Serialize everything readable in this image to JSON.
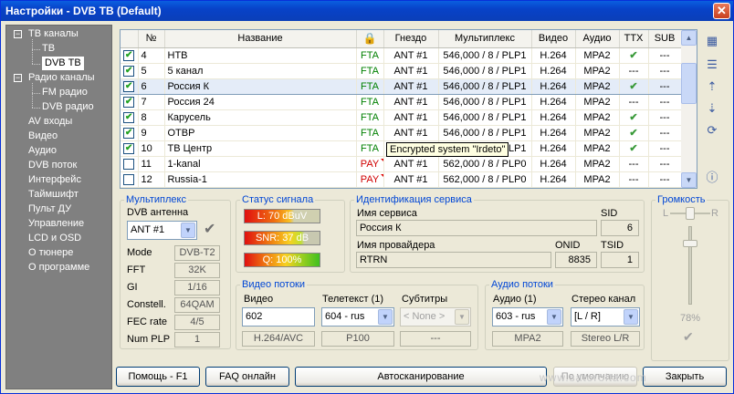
{
  "window": {
    "title": "Настройки - DVB TB (Default)",
    "close_label": "✕"
  },
  "tree": [
    {
      "label": "ТВ каналы",
      "level": 0,
      "toggle": "−"
    },
    {
      "label": "ТВ",
      "level": 1
    },
    {
      "label": "DVB ТВ",
      "level": 1,
      "selected": true
    },
    {
      "label": "Радио каналы",
      "level": 0,
      "toggle": "−"
    },
    {
      "label": "FM радио",
      "level": 1
    },
    {
      "label": "DVB радио",
      "level": 1
    },
    {
      "label": "AV входы",
      "level": 0
    },
    {
      "label": "Видео",
      "level": 0
    },
    {
      "label": "Аудио",
      "level": 0
    },
    {
      "label": "DVB поток",
      "level": 0
    },
    {
      "label": "Интерфейс",
      "level": 0
    },
    {
      "label": "Таймшифт",
      "level": 0
    },
    {
      "label": "Пульт ДУ",
      "level": 0
    },
    {
      "label": "Управление",
      "level": 0
    },
    {
      "label": "LCD и OSD",
      "level": 0
    },
    {
      "label": "О тюнере",
      "level": 0
    },
    {
      "label": "О программе",
      "level": 0
    }
  ],
  "table": {
    "columns": [
      "№",
      "Название",
      "",
      "Гнездо",
      "Мультиплекс",
      "Видео",
      "Аудио",
      "TTX",
      "SUB"
    ],
    "rows": [
      {
        "checked": true,
        "num": "4",
        "name": "НТВ",
        "enc": "FTA",
        "socket": "ANT #1",
        "mux": "546,000 / 8 / PLP1",
        "video": "H.264",
        "audio": "MPA2",
        "ttx": "✔",
        "sub": "---"
      },
      {
        "checked": true,
        "num": "5",
        "name": "5 канал",
        "enc": "FTA",
        "socket": "ANT #1",
        "mux": "546,000 / 8 / PLP1",
        "video": "H.264",
        "audio": "MPA2",
        "ttx": "---",
        "sub": "---"
      },
      {
        "checked": true,
        "num": "6",
        "name": "Россия К",
        "enc": "FTA",
        "socket": "ANT #1",
        "mux": "546,000 / 8 / PLP1",
        "video": "H.264",
        "audio": "MPA2",
        "ttx": "✔",
        "sub": "---",
        "selected": true
      },
      {
        "checked": true,
        "num": "7",
        "name": "Россия 24",
        "enc": "FTA",
        "socket": "ANT #1",
        "mux": "546,000 / 8 / PLP1",
        "video": "H.264",
        "audio": "MPA2",
        "ttx": "---",
        "sub": "---"
      },
      {
        "checked": true,
        "num": "8",
        "name": "Карусель",
        "enc": "FTA",
        "socket": "ANT #1",
        "mux": "546,000 / 8 / PLP1",
        "video": "H.264",
        "audio": "MPA2",
        "ttx": "✔",
        "sub": "---"
      },
      {
        "checked": true,
        "num": "9",
        "name": "ОТВР",
        "enc": "FTA",
        "socket": "ANT #1",
        "mux": "546,000 / 8 / PLP1",
        "video": "H.264",
        "audio": "MPA2",
        "ttx": "✔",
        "sub": "---"
      },
      {
        "checked": true,
        "num": "10",
        "name": "ТВ Центр",
        "enc": "FTA",
        "socket": "ANT #1",
        "mux": "546,000 / 8 / PLP1",
        "video": "H.264",
        "audio": "MPA2",
        "ttx": "✔",
        "sub": "---"
      },
      {
        "checked": false,
        "num": "11",
        "name": "1-kanal",
        "enc": "PAY",
        "socket": "ANT #1",
        "mux": "562,000 / 8 / PLP0",
        "video": "H.264",
        "audio": "MPA2",
        "ttx": "---",
        "sub": "---"
      },
      {
        "checked": false,
        "num": "12",
        "name": "Russia-1",
        "enc": "PAY",
        "socket": "ANT #1",
        "mux": "562,000 / 8 / PLP0",
        "video": "H.264",
        "audio": "MPA2",
        "ttx": "---",
        "sub": "---"
      }
    ]
  },
  "tooltip": "Encrypted system \"Irdeto\"",
  "multiplex": {
    "legend": "Мультиплекс",
    "antenna_label": "DVB антенна",
    "antenna_value": "ANT #1",
    "fields": [
      {
        "label": "Mode",
        "value": "DVB-T2"
      },
      {
        "label": "FFT",
        "value": "32K"
      },
      {
        "label": "GI",
        "value": "1/16"
      },
      {
        "label": "Constell.",
        "value": "64QAM"
      },
      {
        "label": "FEC rate",
        "value": "4/5"
      },
      {
        "label": "Num PLP",
        "value": "1"
      }
    ]
  },
  "signal": {
    "legend": "Статус сигнала",
    "level": "L: 70 dBuV",
    "snr": "SNR: 37 dB",
    "quality": "Q: 100%",
    "quality_value": 100
  },
  "service": {
    "legend": "Идентификация сервиса",
    "name_label": "Имя сервиса",
    "name_value": "Россия К",
    "sid_label": "SID",
    "sid_value": "6",
    "provider_label": "Имя провайдера",
    "provider_value": "RTRN",
    "onid_label": "ONID",
    "onid_value": "8835",
    "tsid_label": "TSID",
    "tsid_value": "1"
  },
  "video_streams": {
    "legend": "Видео потоки",
    "video_label": "Видео",
    "video_value": "602",
    "video_codec": "H.264/AVC",
    "teletext_label": "Телетекст (1)",
    "teletext_value": "604 - rus",
    "teletext_info": "P100",
    "subs_label": "Субтитры",
    "subs_value": "< None >",
    "subs_info": "---"
  },
  "audio_streams": {
    "legend": "Аудио потоки",
    "audio_label": "Аудио (1)",
    "audio_value": "603 - rus",
    "audio_codec": "MPA2",
    "stereo_label": "Стерео канал",
    "stereo_value": "[L / R]",
    "stereo_info": "Stereo L/R"
  },
  "volume": {
    "legend": "Громкость",
    "left": "L",
    "right": "R",
    "percent_label": "78%",
    "level": 78
  },
  "buttons": {
    "help": "Помощь - F1",
    "faq": "FAQ онлайн",
    "autoscan": "Автосканирование",
    "default": "По умолчанию",
    "close": "Закрыть"
  },
  "watermark": "www.satoroita.com"
}
